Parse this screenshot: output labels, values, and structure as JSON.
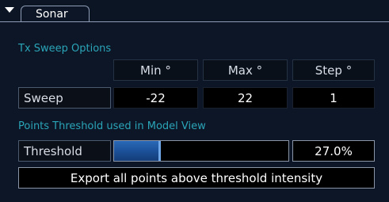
{
  "tab": {
    "label": "Sonar"
  },
  "sweep_options": {
    "title": "Tx Sweep Options",
    "headers": {
      "min": "Min °",
      "max": "Max °",
      "step": "Step °"
    },
    "row": {
      "label": "Sweep",
      "min": "-22",
      "max": "22",
      "step": "1"
    }
  },
  "points_threshold": {
    "title": "Points Threshold used in Model View",
    "label": "Threshold",
    "value_text": "27.0%",
    "level": 0.27
  },
  "export": {
    "label": "Export all points above threshold intensity"
  },
  "colors": {
    "accent_text": "#2aa5b8",
    "slider_fill": "#1b4f96",
    "slider_handle": "#6ea6e8"
  },
  "icons": {
    "collapse": "triangle-down-icon"
  }
}
